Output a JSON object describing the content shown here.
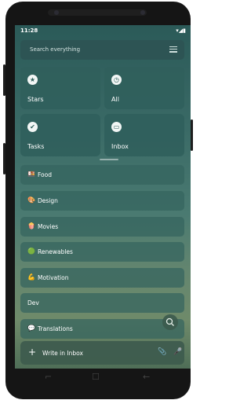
{
  "status_bar": {
    "time": "11:28",
    "icons": "▾◢▮"
  },
  "search": {
    "placeholder": "Search everything",
    "menu_icon": "menu-icon"
  },
  "quick_tiles": [
    {
      "label": "Stars",
      "icon": "star-icon",
      "glyph": "★"
    },
    {
      "label": "All",
      "icon": "clock-icon",
      "glyph": "◷"
    },
    {
      "label": "Tasks",
      "icon": "check-icon",
      "glyph": "✔"
    },
    {
      "label": "Inbox",
      "icon": "inbox-icon",
      "glyph": "▭"
    }
  ],
  "lists": [
    {
      "emoji": "🍱",
      "label": "Food"
    },
    {
      "emoji": "🎨",
      "label": "Design"
    },
    {
      "emoji": "🍿",
      "label": "Movies"
    },
    {
      "emoji": "🟢",
      "label": "Renewables"
    },
    {
      "emoji": "💪",
      "label": "Motivation"
    },
    {
      "emoji": "",
      "label": "Dev"
    },
    {
      "emoji": "💬",
      "label": "Translations"
    }
  ],
  "composer": {
    "plus": "+",
    "placeholder": "Write in Inbox",
    "attach_glyph": "📎",
    "mic_glyph": "🎤"
  },
  "nav_bar": {
    "back_recent": "⌐",
    "home": "☐",
    "back": "←"
  },
  "colors": {
    "tile_bg": "#30605c",
    "screen_top": "#2b5a58",
    "frame": "#151515"
  }
}
